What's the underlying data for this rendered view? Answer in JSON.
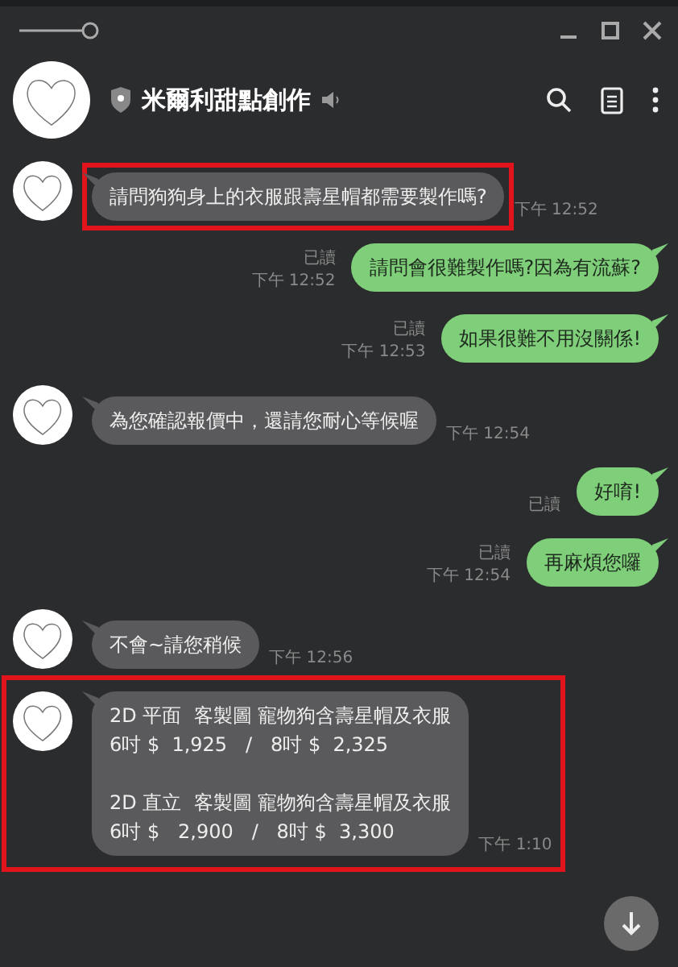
{
  "chat": {
    "title": "米爾利甜點創作"
  },
  "messages": [
    {
      "kind": "incoming",
      "text": "請問狗狗身上的衣服跟壽星帽都需要製作嗎?",
      "time": "下午 12:52",
      "highlighted": true
    },
    {
      "kind": "outgoing",
      "text": "請問會很難製作嗎?因為有流蘇?",
      "read": "已讀",
      "time": "下午 12:52"
    },
    {
      "kind": "outgoing",
      "text": "如果很難不用沒關係!",
      "read": "已讀",
      "time": "下午 12:53"
    },
    {
      "kind": "incoming",
      "text": "為您確認報價中，還請您耐心等候喔",
      "time": "下午 12:54",
      "highlighted": false
    },
    {
      "kind": "outgoing",
      "text": "好唷!",
      "read": "已讀"
    },
    {
      "kind": "outgoing",
      "text": "再麻煩您囉",
      "read": "已讀",
      "time": "下午 12:54"
    },
    {
      "kind": "incoming",
      "text": "不會~請您稍候",
      "time": "下午 12:56",
      "highlighted": false
    },
    {
      "kind": "incoming",
      "text": "2D 平面  客製圖 寵物狗含壽星帽及衣服\n6吋 $  1,925   /   8吋 $  2,325\n\n2D 直立  客製圖 寵物狗含壽星帽及衣服\n6吋 $   2,900   /   8吋 $  3,300",
      "time": "下午 1:10",
      "highlighted": true
    }
  ]
}
